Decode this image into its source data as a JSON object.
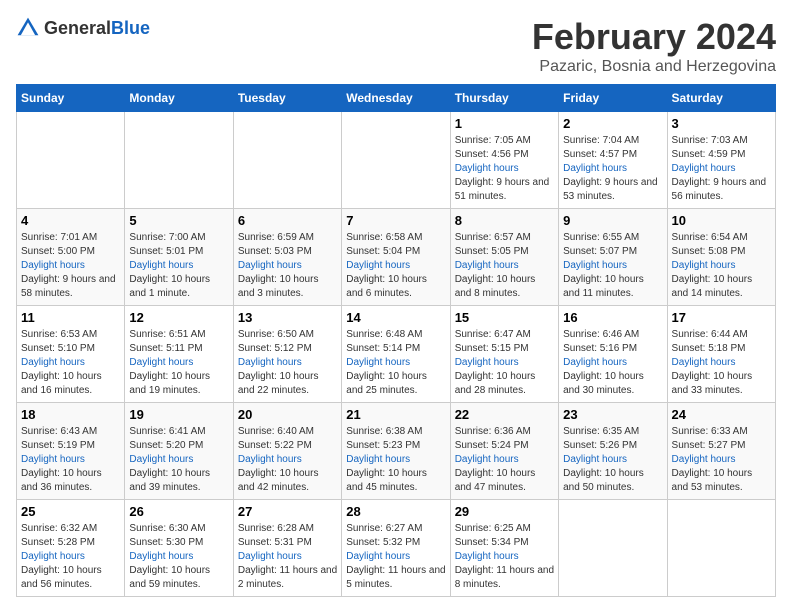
{
  "header": {
    "logo": {
      "general": "General",
      "blue": "Blue"
    },
    "title": "February 2024",
    "location": "Pazaric, Bosnia and Herzegovina"
  },
  "calendar": {
    "days_of_week": [
      "Sunday",
      "Monday",
      "Tuesday",
      "Wednesday",
      "Thursday",
      "Friday",
      "Saturday"
    ],
    "weeks": [
      [
        {
          "num": "",
          "sunrise": "",
          "sunset": "",
          "daylight": ""
        },
        {
          "num": "",
          "sunrise": "",
          "sunset": "",
          "daylight": ""
        },
        {
          "num": "",
          "sunrise": "",
          "sunset": "",
          "daylight": ""
        },
        {
          "num": "",
          "sunrise": "",
          "sunset": "",
          "daylight": ""
        },
        {
          "num": "1",
          "sunrise": "7:05 AM",
          "sunset": "4:56 PM",
          "daylight": "9 hours and 51 minutes."
        },
        {
          "num": "2",
          "sunrise": "7:04 AM",
          "sunset": "4:57 PM",
          "daylight": "9 hours and 53 minutes."
        },
        {
          "num": "3",
          "sunrise": "7:03 AM",
          "sunset": "4:59 PM",
          "daylight": "9 hours and 56 minutes."
        }
      ],
      [
        {
          "num": "4",
          "sunrise": "7:01 AM",
          "sunset": "5:00 PM",
          "daylight": "9 hours and 58 minutes."
        },
        {
          "num": "5",
          "sunrise": "7:00 AM",
          "sunset": "5:01 PM",
          "daylight": "10 hours and 1 minute."
        },
        {
          "num": "6",
          "sunrise": "6:59 AM",
          "sunset": "5:03 PM",
          "daylight": "10 hours and 3 minutes."
        },
        {
          "num": "7",
          "sunrise": "6:58 AM",
          "sunset": "5:04 PM",
          "daylight": "10 hours and 6 minutes."
        },
        {
          "num": "8",
          "sunrise": "6:57 AM",
          "sunset": "5:05 PM",
          "daylight": "10 hours and 8 minutes."
        },
        {
          "num": "9",
          "sunrise": "6:55 AM",
          "sunset": "5:07 PM",
          "daylight": "10 hours and 11 minutes."
        },
        {
          "num": "10",
          "sunrise": "6:54 AM",
          "sunset": "5:08 PM",
          "daylight": "10 hours and 14 minutes."
        }
      ],
      [
        {
          "num": "11",
          "sunrise": "6:53 AM",
          "sunset": "5:10 PM",
          "daylight": "10 hours and 16 minutes."
        },
        {
          "num": "12",
          "sunrise": "6:51 AM",
          "sunset": "5:11 PM",
          "daylight": "10 hours and 19 minutes."
        },
        {
          "num": "13",
          "sunrise": "6:50 AM",
          "sunset": "5:12 PM",
          "daylight": "10 hours and 22 minutes."
        },
        {
          "num": "14",
          "sunrise": "6:48 AM",
          "sunset": "5:14 PM",
          "daylight": "10 hours and 25 minutes."
        },
        {
          "num": "15",
          "sunrise": "6:47 AM",
          "sunset": "5:15 PM",
          "daylight": "10 hours and 28 minutes."
        },
        {
          "num": "16",
          "sunrise": "6:46 AM",
          "sunset": "5:16 PM",
          "daylight": "10 hours and 30 minutes."
        },
        {
          "num": "17",
          "sunrise": "6:44 AM",
          "sunset": "5:18 PM",
          "daylight": "10 hours and 33 minutes."
        }
      ],
      [
        {
          "num": "18",
          "sunrise": "6:43 AM",
          "sunset": "5:19 PM",
          "daylight": "10 hours and 36 minutes."
        },
        {
          "num": "19",
          "sunrise": "6:41 AM",
          "sunset": "5:20 PM",
          "daylight": "10 hours and 39 minutes."
        },
        {
          "num": "20",
          "sunrise": "6:40 AM",
          "sunset": "5:22 PM",
          "daylight": "10 hours and 42 minutes."
        },
        {
          "num": "21",
          "sunrise": "6:38 AM",
          "sunset": "5:23 PM",
          "daylight": "10 hours and 45 minutes."
        },
        {
          "num": "22",
          "sunrise": "6:36 AM",
          "sunset": "5:24 PM",
          "daylight": "10 hours and 47 minutes."
        },
        {
          "num": "23",
          "sunrise": "6:35 AM",
          "sunset": "5:26 PM",
          "daylight": "10 hours and 50 minutes."
        },
        {
          "num": "24",
          "sunrise": "6:33 AM",
          "sunset": "5:27 PM",
          "daylight": "10 hours and 53 minutes."
        }
      ],
      [
        {
          "num": "25",
          "sunrise": "6:32 AM",
          "sunset": "5:28 PM",
          "daylight": "10 hours and 56 minutes."
        },
        {
          "num": "26",
          "sunrise": "6:30 AM",
          "sunset": "5:30 PM",
          "daylight": "10 hours and 59 minutes."
        },
        {
          "num": "27",
          "sunrise": "6:28 AM",
          "sunset": "5:31 PM",
          "daylight": "11 hours and 2 minutes."
        },
        {
          "num": "28",
          "sunrise": "6:27 AM",
          "sunset": "5:32 PM",
          "daylight": "11 hours and 5 minutes."
        },
        {
          "num": "29",
          "sunrise": "6:25 AM",
          "sunset": "5:34 PM",
          "daylight": "11 hours and 8 minutes."
        },
        {
          "num": "",
          "sunrise": "",
          "sunset": "",
          "daylight": ""
        },
        {
          "num": "",
          "sunrise": "",
          "sunset": "",
          "daylight": ""
        }
      ]
    ]
  }
}
